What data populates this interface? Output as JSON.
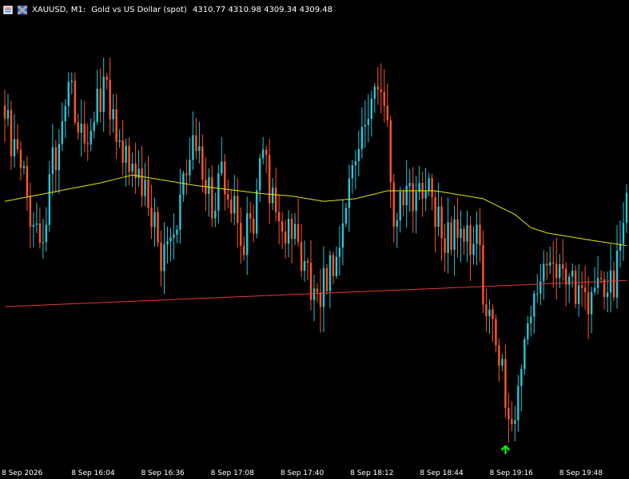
{
  "header": {
    "symbol": "XAUUSD, M1:",
    "description": "Gold vs US Dollar (spot)",
    "ohlc": "4310.77 4310.98 4309.34 4309.48"
  },
  "icons": {
    "menu": "chart-menu-icon",
    "flag": "symbol-flag-icon"
  },
  "colors": {
    "background": "#000000",
    "bull": "#26c6da",
    "bear": "#ff5722",
    "ma_slow": "#e53935",
    "ma_fast": "#e6e600",
    "signal": "#00ff00",
    "text": "#ffffff"
  },
  "chart_data": {
    "type": "candlestick",
    "x_tick_labels": [
      "8 Sep 2026",
      "8 Sep 16:04",
      "8 Sep 16:36",
      "8 Sep 17:08",
      "8 Sep 17:40",
      "8 Sep 18:12",
      "8 Sep 18:44",
      "8 Sep 19:16",
      "8 Sep 19:48"
    ],
    "candle_count": 196,
    "price_range": [
      4304.5,
      4321.0
    ],
    "keypoints": [
      [
        0,
        4317.5
      ],
      [
        4,
        4315.5
      ],
      [
        8,
        4314.0
      ],
      [
        12,
        4313.0
      ],
      [
        15,
        4315.5
      ],
      [
        18,
        4317.0
      ],
      [
        20,
        4319.0
      ],
      [
        22,
        4317.5
      ],
      [
        26,
        4317.0
      ],
      [
        29,
        4318.0
      ],
      [
        32,
        4318.5
      ],
      [
        35,
        4317.0
      ],
      [
        39,
        4315.5
      ],
      [
        43,
        4315.0
      ],
      [
        46,
        4313.5
      ],
      [
        50,
        4311.8
      ],
      [
        53,
        4313.0
      ],
      [
        56,
        4314.5
      ],
      [
        59,
        4316.5
      ],
      [
        62,
        4315.0
      ],
      [
        65,
        4314.0
      ],
      [
        68,
        4315.0
      ],
      [
        71,
        4314.5
      ],
      [
        74,
        4312.5
      ],
      [
        78,
        4313.5
      ],
      [
        81,
        4316.0
      ],
      [
        84,
        4314.0
      ],
      [
        87,
        4313.5
      ],
      [
        90,
        4313.0
      ],
      [
        93,
        4312.0
      ],
      [
        96,
        4310.8
      ],
      [
        100,
        4311.0
      ],
      [
        104,
        4312.0
      ],
      [
        107,
        4314.0
      ],
      [
        110,
        4316.5
      ],
      [
        113,
        4317.5
      ],
      [
        116,
        4318.0
      ],
      [
        119,
        4318.5
      ],
      [
        121,
        4315.0
      ],
      [
        123,
        4313.0
      ],
      [
        126,
        4315.5
      ],
      [
        129,
        4314.0
      ],
      [
        132,
        4314.5
      ],
      [
        135,
        4314.0
      ],
      [
        138,
        4313.0
      ],
      [
        142,
        4313.0
      ],
      [
        145,
        4312.5
      ],
      [
        148,
        4313.0
      ],
      [
        150,
        4311.0
      ],
      [
        152,
        4310.0
      ],
      [
        154,
        4309.0
      ],
      [
        156,
        4307.5
      ],
      [
        157,
        4306.0
      ],
      [
        158,
        4305.5
      ],
      [
        160,
        4306.0
      ],
      [
        162,
        4307.5
      ],
      [
        164,
        4309.0
      ],
      [
        166,
        4310.5
      ],
      [
        168,
        4311.5
      ],
      [
        170,
        4311.0
      ],
      [
        173,
        4311.5
      ],
      [
        176,
        4311.5
      ],
      [
        179,
        4311.0
      ],
      [
        182,
        4310.5
      ],
      [
        185,
        4311.0
      ],
      [
        188,
        4310.5
      ],
      [
        191,
        4311.0
      ],
      [
        193,
        4312.5
      ],
      [
        196,
        4314.5
      ]
    ],
    "moving_averages": [
      {
        "color": "#e6e600",
        "points": [
          [
            0,
            4314.2
          ],
          [
            30,
            4314.9
          ],
          [
            40,
            4315.2
          ],
          [
            60,
            4314.8
          ],
          [
            80,
            4314.5
          ],
          [
            90,
            4314.4
          ],
          [
            100,
            4314.2
          ],
          [
            110,
            4314.3
          ],
          [
            120,
            4314.6
          ],
          [
            135,
            4314.6
          ],
          [
            150,
            4314.3
          ],
          [
            160,
            4313.7
          ],
          [
            165,
            4313.2
          ],
          [
            170,
            4313.0
          ],
          [
            185,
            4312.7
          ],
          [
            196,
            4312.5
          ]
        ]
      },
      {
        "color": "#e53935",
        "points": [
          [
            0,
            4310.2
          ],
          [
            196,
            4311.2
          ]
        ]
      }
    ],
    "markers": [
      {
        "index": 157,
        "type": "buy-arrow",
        "color": "#00ff00",
        "price": 4304.9
      }
    ]
  }
}
